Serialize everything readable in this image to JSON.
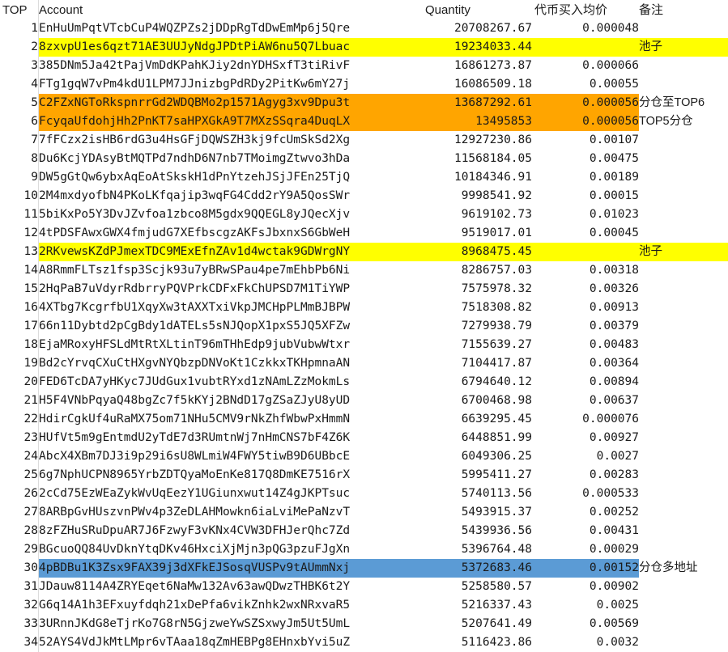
{
  "headers": {
    "top": "TOP",
    "account": "Account",
    "quantity": "Quantity",
    "avg_price": "代币买入均价",
    "note": "备注"
  },
  "colors": {
    "yellow": "#ffff00",
    "orange": "#ffa500",
    "blue": "#5b9bd5"
  },
  "rows": [
    {
      "top": "1",
      "account": "EnHuUmPqtVTcbCuP4WQZPZs2jDDpRgTdDwEmMp6j5Qre",
      "quantity": "20708267.67",
      "price": "0.000048",
      "note": "",
      "hl": ""
    },
    {
      "top": "2",
      "account": "8zxvpU1es6qzt71AE3UUJyNdgJPDtPiAW6nu5Q7Lbuac",
      "quantity": "19234033.44",
      "price": "",
      "note": "池子",
      "hl": "yellow"
    },
    {
      "top": "3",
      "account": "385DNm5Ja42tPajVmDdKPahKJiy2dnYDHSxfT3tiRivF",
      "quantity": "16861273.87",
      "price": "0.000066",
      "note": "",
      "hl": ""
    },
    {
      "top": "4",
      "account": "FTg1gqW7vPm4kdU1LPM7JJnizbgPdRDy2PitKw6mY27j",
      "quantity": "16086509.18",
      "price": "0.00055",
      "note": "",
      "hl": ""
    },
    {
      "top": "5",
      "account": "C2FZxNGToRkspnrrGd2WDQBMo2p1571Agyg3xv9Dpu3t",
      "quantity": "13687292.61",
      "price": "0.000056",
      "note": "分仓至TOP6",
      "hl": "orange"
    },
    {
      "top": "6",
      "account": "FcyqaUfdohjHh2PnKT7saHPXGkA9T7MXzSSqra4DuqLX",
      "quantity": "13495853",
      "price": "0.000056",
      "note": "TOP5分仓",
      "hl": "orange"
    },
    {
      "top": "7",
      "account": "7fFCzx2isHB6rdG3u4HsGFjDQWSZH3kj9fcUmSkSd2Xg",
      "quantity": "12927230.86",
      "price": "0.00107",
      "note": "",
      "hl": ""
    },
    {
      "top": "8",
      "account": "Du6KcjYDAsyBtMQTPd7ndhD6N7nb7TMoimgZtwvo3hDa",
      "quantity": "11568184.05",
      "price": "0.00475",
      "note": "",
      "hl": ""
    },
    {
      "top": "9",
      "account": "DW5gGtQw6ybxAqEoAtSkskH1dPnYtzehJSjJFEn25TjQ",
      "quantity": "10184346.91",
      "price": "0.00189",
      "note": "",
      "hl": ""
    },
    {
      "top": "10",
      "account": "2M4mxdyofbN4PKoLKfqajip3wqFG4Cdd2rY9A5QosSWr",
      "quantity": "9998541.92",
      "price": "0.00015",
      "note": "",
      "hl": ""
    },
    {
      "top": "11",
      "account": "5biKxPo5Y3DvJZvfoa1zbco8M5gdx9QQEGL8yJQecXjv",
      "quantity": "9619102.73",
      "price": "0.01023",
      "note": "",
      "hl": ""
    },
    {
      "top": "12",
      "account": "4tPDSFAwxGWX4fmjudG7XEfbscgzAKFsJbxnxS6GbWeH",
      "quantity": "9519017.01",
      "price": "0.00045",
      "note": "",
      "hl": ""
    },
    {
      "top": "13",
      "account": "2RKvewsKZdPJmexTDC9MExEfnZAv1d4wctak9GDWrgNY",
      "quantity": "8968475.45",
      "price": "",
      "note": "池子",
      "hl": "yellow"
    },
    {
      "top": "14",
      "account": "A8RmmFLTsz1fsp3Scjk93u7yBRwSPau4pe7mEhbPb6Ni",
      "quantity": "8286757.03",
      "price": "0.00318",
      "note": "",
      "hl": ""
    },
    {
      "top": "15",
      "account": "2HqPaB7uVdyrRdbrryPQVPrkCDFxFkChUPSD7M1TiYWP",
      "quantity": "7575978.32",
      "price": "0.00326",
      "note": "",
      "hl": ""
    },
    {
      "top": "16",
      "account": "4XTbg7KcgrfbU1XqyXw3tAXXTxiVkpJMCHpPLMmBJBPW",
      "quantity": "7518308.82",
      "price": "0.00913",
      "note": "",
      "hl": ""
    },
    {
      "top": "17",
      "account": "66n11Dybtd2pCgBdy1dATELs5sNJQopX1pxS5JQ5XFZw",
      "quantity": "7279938.79",
      "price": "0.00379",
      "note": "",
      "hl": ""
    },
    {
      "top": "18",
      "account": "EjaMRoxyHFSLdMtRtXLtinT96mTHhEdp9jubVubwWtxr",
      "quantity": "7155639.27",
      "price": "0.00483",
      "note": "",
      "hl": ""
    },
    {
      "top": "19",
      "account": "Bd2cYrvqCXuCtHXgvNYQbzpDNVoKt1CzkkxTKHpmnaAN",
      "quantity": "7104417.87",
      "price": "0.00364",
      "note": "",
      "hl": ""
    },
    {
      "top": "20",
      "account": "FED6TcDA7yHKyc7JUdGux1vubtRYxd1zNAmLZzMokmLs",
      "quantity": "6794640.12",
      "price": "0.00894",
      "note": "",
      "hl": ""
    },
    {
      "top": "21",
      "account": "H5F4VNbPqyaQ48bgZc7f5kKYj2BNdD17gZSaZJyU8yUD",
      "quantity": "6700468.98",
      "price": "0.00637",
      "note": "",
      "hl": ""
    },
    {
      "top": "22",
      "account": "HdirCgkUf4uRaMX75om71NHu5CMV9rNkZhfWbwPxHmmN",
      "quantity": "6639295.45",
      "price": "0.000076",
      "note": "",
      "hl": ""
    },
    {
      "top": "23",
      "account": "HUfVt5m9gEntmdU2yTdE7d3RUmtnWj7nHmCNS7bF4Z6K",
      "quantity": "6448851.99",
      "price": "0.00927",
      "note": "",
      "hl": ""
    },
    {
      "top": "24",
      "account": "AbcX4XBm7DJ3i9p29i6sU8WLmiW4FWY5tiwB9D6UBbcE",
      "quantity": "6049306.25",
      "price": "0.0027",
      "note": "",
      "hl": ""
    },
    {
      "top": "25",
      "account": "6g7NphUCPN8965YrbZDTQyaMoEnKe817Q8DmKE7516rX",
      "quantity": "5995411.27",
      "price": "0.00283",
      "note": "",
      "hl": ""
    },
    {
      "top": "26",
      "account": "2cCd75EzWEaZykWvUqEezY1UGiunxwut14Z4gJKPTsuc",
      "quantity": "5740113.56",
      "price": "0.000533",
      "note": "",
      "hl": ""
    },
    {
      "top": "27",
      "account": "8ARBpGvHUszvnPWv4p3ZeDLAHMowkn6iaLviMePaNzvT",
      "quantity": "5493915.37",
      "price": "0.00252",
      "note": "",
      "hl": ""
    },
    {
      "top": "28",
      "account": "8zFZHuSRuDpuAR7J6FzwyF3vKNx4CVW3DFHJerQhc7Zd",
      "quantity": "5439936.56",
      "price": "0.00431",
      "note": "",
      "hl": ""
    },
    {
      "top": "29",
      "account": "BGcuoQQ84UvDknYtqDKv46HxciXjMjn3pQG3pzuFJgXn",
      "quantity": "5396764.48",
      "price": "0.00029",
      "note": "",
      "hl": ""
    },
    {
      "top": "30",
      "account": "4pBDBu1K3Zsx9FAX39j3dXFkEJSosqVUSPv9tAUmmNxj",
      "quantity": "5372683.46",
      "price": "0.00152",
      "note": "分仓多地址",
      "hl": "blue"
    },
    {
      "top": "31",
      "account": "JDauw8114A4ZRYEqet6NaMw132Av63awQDwzTHBK6t2Y",
      "quantity": "5258580.57",
      "price": "0.00902",
      "note": "",
      "hl": ""
    },
    {
      "top": "32",
      "account": "G6q14A1h3EFxuyfdqh21xDePfa6vikZnhk2wxNRxvaR5",
      "quantity": "5216337.43",
      "price": "0.0025",
      "note": "",
      "hl": ""
    },
    {
      "top": "33",
      "account": "3URnnJKdG8eTjrKo7G8rN5GjzweYwSZSxwyJm5Ut5UmL",
      "quantity": "5207641.49",
      "price": "0.00569",
      "note": "",
      "hl": ""
    },
    {
      "top": "34",
      "account": "52AYS4VdJkMtLMpr6vTAaa18qZmHEBPg8EHnxbYvi5uZ",
      "quantity": "5116423.86",
      "price": "0.0032",
      "note": "",
      "hl": ""
    }
  ]
}
